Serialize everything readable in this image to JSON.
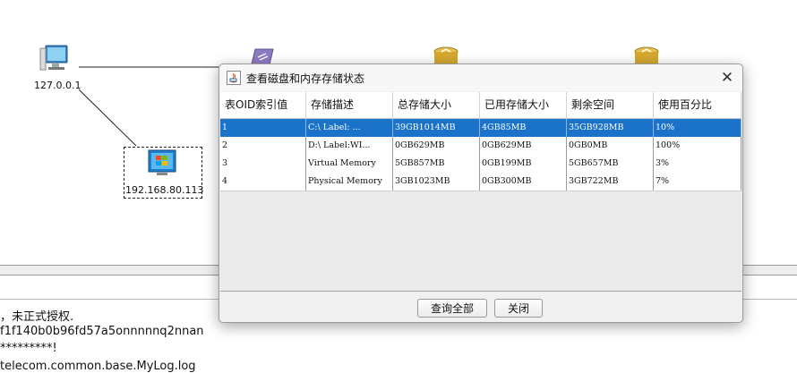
{
  "topology": {
    "nodes": [
      {
        "label": "127.0.0.1",
        "icon": "computer-icon"
      },
      {
        "label": "192.168.80.113",
        "icon": "windows-host-icon"
      },
      {
        "label": "",
        "icon": "router-icon"
      },
      {
        "label": "",
        "icon": "database-icon"
      },
      {
        "label": "",
        "icon": "database-icon"
      }
    ]
  },
  "log": {
    "lines": [
      "，未正式授权.",
      "f1f140b0b96fd57a5onnnnnq2nnan",
      "*********!",
      "telecom.common.base.MyLog.log"
    ]
  },
  "dialog": {
    "title": "查看磁盘和内存存储状态",
    "close_glyph": "✕",
    "columns": [
      "表OID索引值",
      "存储描述",
      "总存储大小",
      "已用存储大小",
      "剩余空间",
      "使用百分比"
    ],
    "rows": [
      [
        "1",
        "C:\\ Label:  ...",
        "39GB1014MB",
        "4GB85MB",
        "35GB928MB",
        "10%"
      ],
      [
        "2",
        "D:\\ Label:WI...",
        "0GB629MB",
        "0GB629MB",
        "0GB0MB",
        "100%"
      ],
      [
        "3",
        "Virtual Memory",
        "5GB857MB",
        "0GB199MB",
        "5GB657MB",
        "3%"
      ],
      [
        "4",
        "Physical Memory",
        "3GB1023MB",
        "0GB300MB",
        "3GB722MB",
        "7%"
      ]
    ],
    "selected_row": 1,
    "buttons": {
      "query_all": "查询全部",
      "close": "关闭"
    }
  },
  "colors": {
    "selection": "#1a73c9",
    "accent": "#1a73c9"
  }
}
